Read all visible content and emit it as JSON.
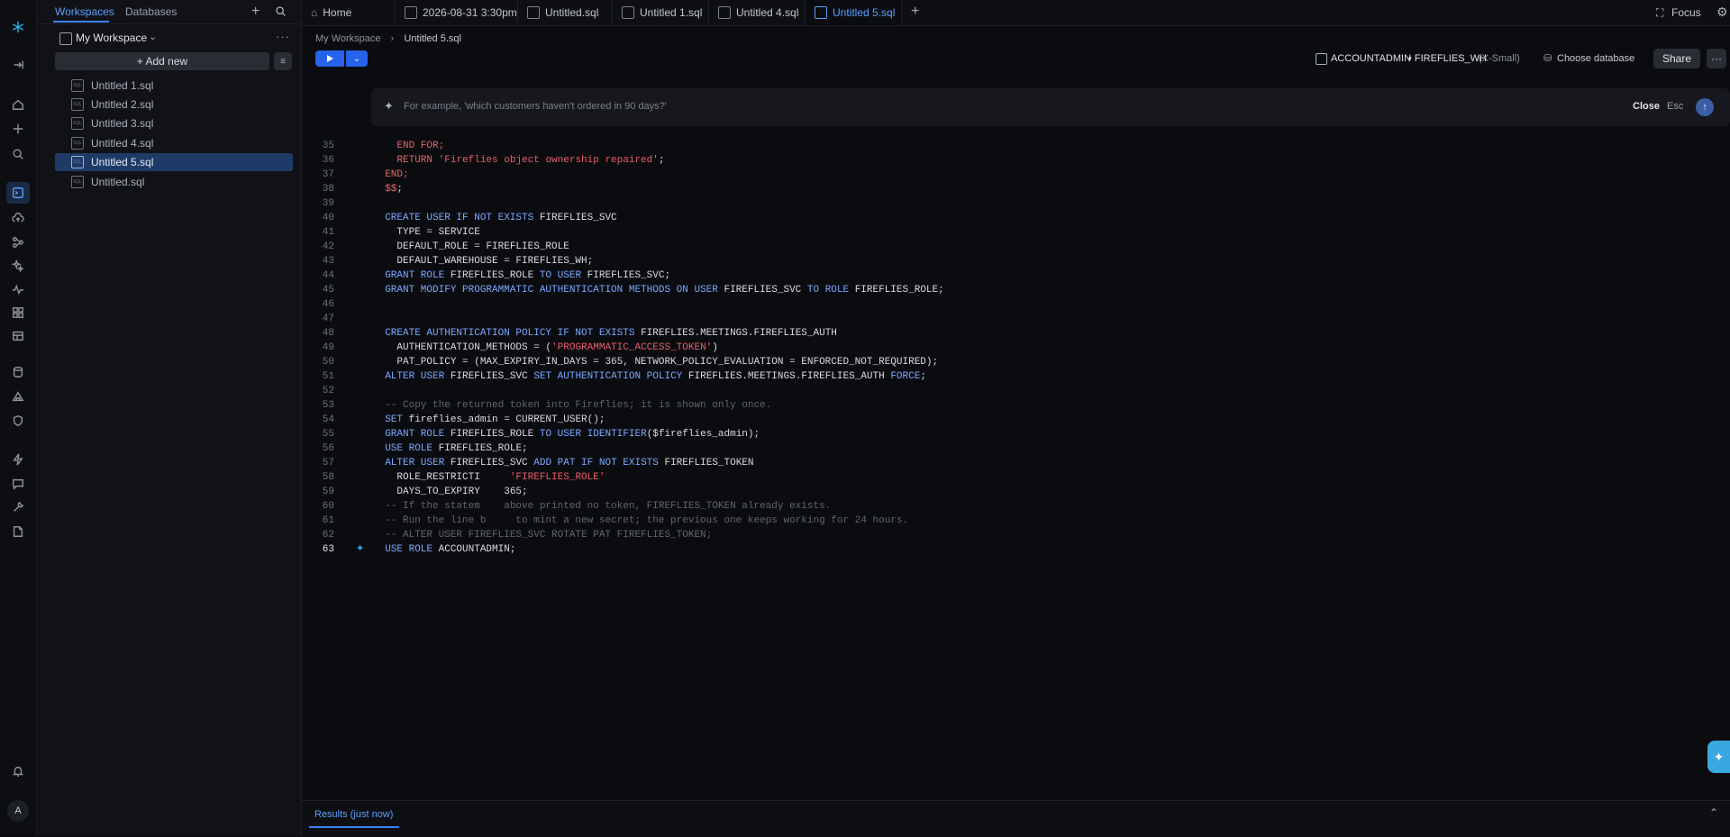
{
  "sidebar": {
    "tabs": [
      "Workspaces",
      "Databases"
    ],
    "workspace_name": "My Workspace",
    "add_new_label": "+ Add new",
    "files": [
      "Untitled 1.sql",
      "Untitled 2.sql",
      "Untitled 3.sql",
      "Untitled 4.sql",
      "Untitled 5.sql",
      "Untitled.sql"
    ],
    "active_file_index": 4,
    "user_initial": "A"
  },
  "top_tabs": {
    "items": [
      "Home",
      "2026-08-31 3:30pm",
      "Untitled.sql",
      "Untitled 1.sql",
      "Untitled 4.sql",
      "Untitled 5.sql"
    ],
    "active_index": 5,
    "focus_label": "Focus"
  },
  "editor": {
    "breadcrumb": [
      "My Workspace",
      "Untitled 5.sql"
    ],
    "role_label": "ACCOUNTADMIN",
    "warehouse_label": "• FIREFLIES_WH",
    "warehouse_size": "(X-Small)",
    "choose_db_label": "Choose database",
    "share_label": "Share",
    "ai_placeholder": "For example, 'which customers haven't ordered in 90 days?'",
    "close_label": "Close",
    "esc_label": "Esc"
  },
  "code_lines": [
    {
      "n": "35",
      "parts": [
        [
          "red",
          "    END FOR;"
        ]
      ]
    },
    {
      "n": "36",
      "parts": [
        [
          "red",
          "    RETURN "
        ],
        [
          "str",
          "'Fireflies object ownership repaired'"
        ],
        [
          "tx",
          ";"
        ]
      ]
    },
    {
      "n": "37",
      "parts": [
        [
          "red",
          "  END;"
        ]
      ]
    },
    {
      "n": "38",
      "parts": [
        [
          "red",
          "  $$"
        ],
        [
          "tx",
          ";"
        ]
      ]
    },
    {
      "n": "39",
      "parts": []
    },
    {
      "n": "40",
      "parts": [
        [
          "kw",
          "  CREATE USER IF NOT EXISTS "
        ],
        [
          "tx",
          "FIREFLIES_SVC"
        ]
      ]
    },
    {
      "n": "41",
      "parts": [
        [
          "tx",
          "    TYPE = SERVICE"
        ]
      ]
    },
    {
      "n": "42",
      "parts": [
        [
          "tx",
          "    DEFAULT_ROLE = FIREFLIES_ROLE"
        ]
      ]
    },
    {
      "n": "43",
      "parts": [
        [
          "tx",
          "    DEFAULT_WAREHOUSE = FIREFLIES_WH;"
        ]
      ]
    },
    {
      "n": "44",
      "parts": [
        [
          "kw",
          "  GRANT ROLE "
        ],
        [
          "tx",
          "FIREFLIES_ROLE "
        ],
        [
          "kw",
          "TO USER "
        ],
        [
          "tx",
          "FIREFLIES_SVC;"
        ]
      ]
    },
    {
      "n": "45",
      "parts": [
        [
          "kw",
          "  GRANT MODIFY PROGRAMMATIC AUTHENTICATION METHODS ON USER "
        ],
        [
          "tx",
          "FIREFLIES_SVC "
        ],
        [
          "kw",
          "TO ROLE "
        ],
        [
          "tx",
          "FIREFLIES_ROLE;"
        ]
      ]
    },
    {
      "n": "46",
      "parts": []
    },
    {
      "n": "47",
      "parts": []
    },
    {
      "n": "48",
      "parts": [
        [
          "kw",
          "  CREATE AUTHENTICATION POLICY IF NOT EXISTS "
        ],
        [
          "tx",
          "FIREFLIES.MEETINGS.FIREFLIES_AUTH"
        ]
      ]
    },
    {
      "n": "49",
      "parts": [
        [
          "tx",
          "    AUTHENTICATION_METHODS = ("
        ],
        [
          "str",
          "'PROGRAMMATIC_ACCESS_TOKEN'"
        ],
        [
          "tx",
          ")"
        ]
      ]
    },
    {
      "n": "50",
      "parts": [
        [
          "tx",
          "    PAT_POLICY = (MAX_EXPIRY_IN_DAYS = 365, NETWORK_POLICY_EVALUATION = ENFORCED_NOT_REQUIRED);"
        ]
      ]
    },
    {
      "n": "51",
      "parts": [
        [
          "kw",
          "  ALTER USER "
        ],
        [
          "tx",
          "FIREFLIES_SVC "
        ],
        [
          "kw",
          "SET AUTHENTICATION POLICY "
        ],
        [
          "tx",
          "FIREFLIES.MEETINGS.FIREFLIES_AUTH "
        ],
        [
          "kw",
          "FORCE"
        ],
        [
          "tx",
          ";"
        ]
      ]
    },
    {
      "n": "52",
      "parts": []
    },
    {
      "n": "53",
      "parts": [
        [
          "cm",
          "  -- Copy the returned token into Fireflies; it is shown only once."
        ]
      ]
    },
    {
      "n": "54",
      "parts": [
        [
          "kw",
          "  SET "
        ],
        [
          "tx",
          "fireflies_admin = CURRENT_USER();"
        ]
      ]
    },
    {
      "n": "55",
      "parts": [
        [
          "kw",
          "  GRANT ROLE "
        ],
        [
          "tx",
          "FIREFLIES_ROLE "
        ],
        [
          "kw",
          "TO USER IDENTIFIER"
        ],
        [
          "tx",
          "($fireflies_admin);"
        ]
      ]
    },
    {
      "n": "56",
      "parts": [
        [
          "kw",
          "  USE ROLE "
        ],
        [
          "tx",
          "FIREFLIES_ROLE;"
        ]
      ]
    },
    {
      "n": "57",
      "parts": [
        [
          "kw",
          "  ALTER USER "
        ],
        [
          "tx",
          "FIREFLIES_SVC "
        ],
        [
          "kw",
          "ADD PAT IF NOT EXISTS "
        ],
        [
          "tx",
          "FIREFLIES_TOKEN"
        ]
      ]
    },
    {
      "n": "58",
      "parts": [
        [
          "tx",
          "    ROLE_RESTRICTI     "
        ],
        [
          "str",
          "'FIREFLIES_ROLE'"
        ]
      ]
    },
    {
      "n": "59",
      "parts": [
        [
          "tx",
          "    DAYS_TO_EXPIRY    365;"
        ]
      ]
    },
    {
      "n": "60",
      "parts": [
        [
          "cm",
          "  -- If the statem    above printed no token, FIREFLIES_TOKEN already exists."
        ]
      ]
    },
    {
      "n": "61",
      "parts": [
        [
          "cm",
          "  -- Run the line b     to mint a new secret; the previous one keeps working for 24 hours."
        ]
      ]
    },
    {
      "n": "62",
      "parts": [
        [
          "cm",
          "  -- ALTER USER FIREFLIES_SVC ROTATE PAT FIREFLIES_TOKEN;"
        ]
      ]
    },
    {
      "n": "63",
      "parts": [
        [
          "kw",
          "  USE ROLE "
        ],
        [
          "tx",
          "ACCOUNTADMIN;"
        ]
      ]
    }
  ],
  "active_line": "63",
  "results": {
    "label": "Results (just now)"
  }
}
